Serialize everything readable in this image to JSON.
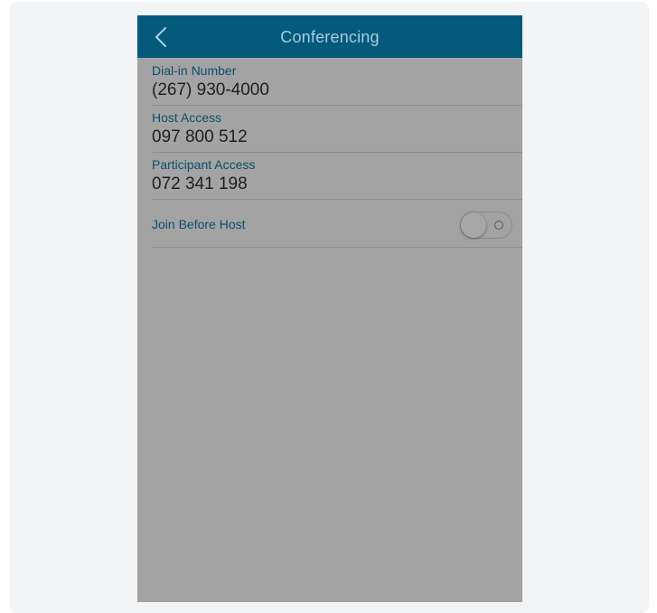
{
  "navbar": {
    "title": "Conferencing",
    "back_icon": "chevron-left-icon"
  },
  "fields": [
    {
      "label": "Dial-in Number",
      "value": "(267) 930-4000"
    },
    {
      "label": "Host Access",
      "value": "097 800 512"
    },
    {
      "label": "Participant Access",
      "value": "072 341 198"
    }
  ],
  "join_before_host": {
    "label": "Join Before Host",
    "enabled": false
  },
  "colors": {
    "navbar_bg": "#045a7a",
    "overlay_bg": "#a3a3a3",
    "label_text": "#0c4f6d",
    "value_text": "#1e1e1e"
  }
}
